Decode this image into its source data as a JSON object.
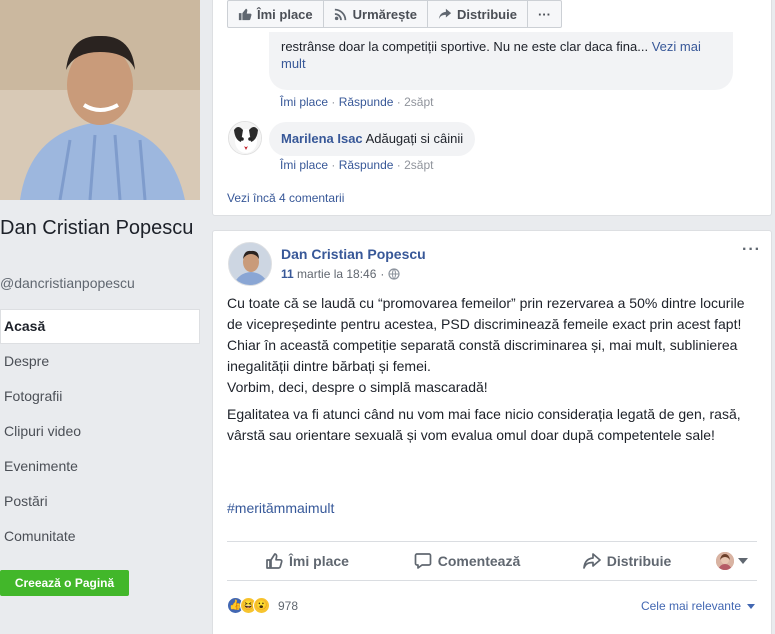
{
  "profile": {
    "name": "Dan Cristian Popescu",
    "handle": "@dancristianpopescu"
  },
  "nav": {
    "items": [
      {
        "label": "Acasă",
        "active": true
      },
      {
        "label": "Despre"
      },
      {
        "label": "Fotografii"
      },
      {
        "label": "Clipuri video"
      },
      {
        "label": "Evenimente"
      },
      {
        "label": "Postări"
      },
      {
        "label": "Comunitate"
      }
    ],
    "create_page": "Creează o Pagină"
  },
  "top_actions": {
    "like": "Îmi place",
    "follow": "Urmărește",
    "share": "Distribuie",
    "more": "···"
  },
  "comments": [
    {
      "text": "restrânse doar la competiții sportive. Nu ne este clar daca fina...",
      "more": "Vezi mai mult",
      "like": "Îmi place",
      "reply": "Răspunde",
      "time": "2săpt"
    },
    {
      "author": "Marilena Isac",
      "text": "Adăugați si câinii",
      "like": "Îmi place",
      "reply": "Răspunde",
      "time": "2săpt"
    }
  ],
  "more_comments": "Vezi încă 4 comentarii",
  "post": {
    "author": "Dan Cristian Popescu",
    "date_day": "11",
    "date_rest": "martie la 18:46",
    "paragraph1": "Cu toate că se laudă cu “promovarea femeilor” prin rezervarea a 50% dintre locurile de vicepreședinte pentru acestea, PSD discriminează femeile exact prin acest fapt!",
    "paragraph2": "Chiar în această competiție separată constă discriminarea și, mai mult, sublinierea inegalității dintre bărbați și femei.",
    "paragraph3": "Vorbim, deci, despre o simplă mascaradă!",
    "paragraph4": "Egalitatea va fi atunci când nu vom mai face nicio considerația legată de gen, rasă, vârstă sau orientare sexuală și vom evalua omul doar după competentele sale!",
    "hashtag": "#meritămmaimult",
    "actions": {
      "like": "Îmi place",
      "comment": "Comentează",
      "share": "Distribuie"
    },
    "reaction_count": "978",
    "sort": "Cele mai relevante"
  },
  "colors": {
    "link_blue": "#385898",
    "green_button": "#42b72a",
    "like_blue": "#4267b2"
  }
}
